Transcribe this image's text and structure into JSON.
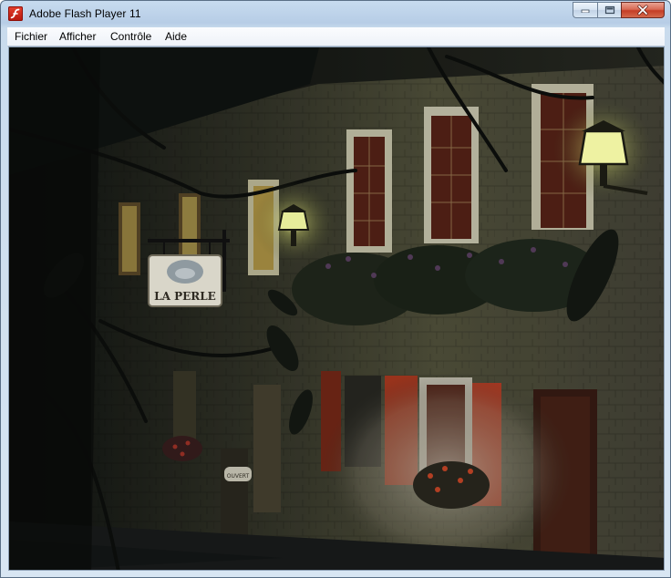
{
  "window": {
    "title": "Adobe Flash Player 11",
    "icon": "flash-player-icon",
    "controls": [
      "minimize-icon",
      "maximize-icon",
      "close-icon"
    ]
  },
  "menu": {
    "items": [
      {
        "label": "Fichier"
      },
      {
        "label": "Afficher"
      },
      {
        "label": "Contrôle"
      },
      {
        "label": "Aide"
      }
    ]
  },
  "scene": {
    "sign_text": "LA PERLE",
    "small_sign_text": "OUVERT"
  }
}
